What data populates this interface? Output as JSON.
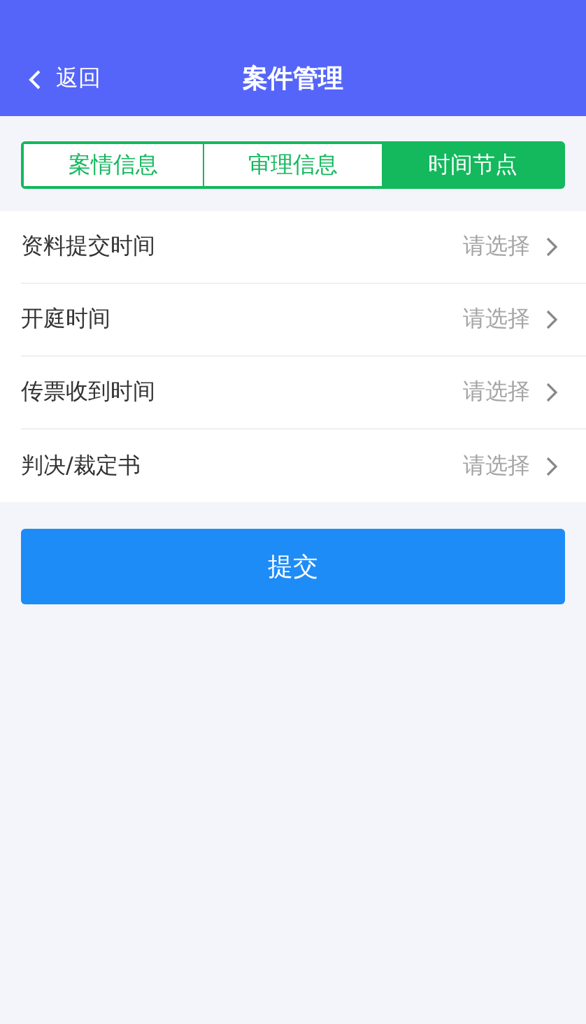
{
  "header": {
    "back": "返回",
    "title": "案件管理"
  },
  "tabs": [
    {
      "label": "案情信息",
      "selected": false
    },
    {
      "label": "审理信息",
      "selected": false
    },
    {
      "label": "时间节点",
      "selected": true
    }
  ],
  "fields": [
    {
      "label": "资料提交时间",
      "placeholder": "请选择"
    },
    {
      "label": "开庭时间",
      "placeholder": "请选择"
    },
    {
      "label": "传票收到时间",
      "placeholder": "请选择"
    },
    {
      "label": "判决/裁定书",
      "placeholder": "请选择"
    }
  ],
  "submit": "提交"
}
